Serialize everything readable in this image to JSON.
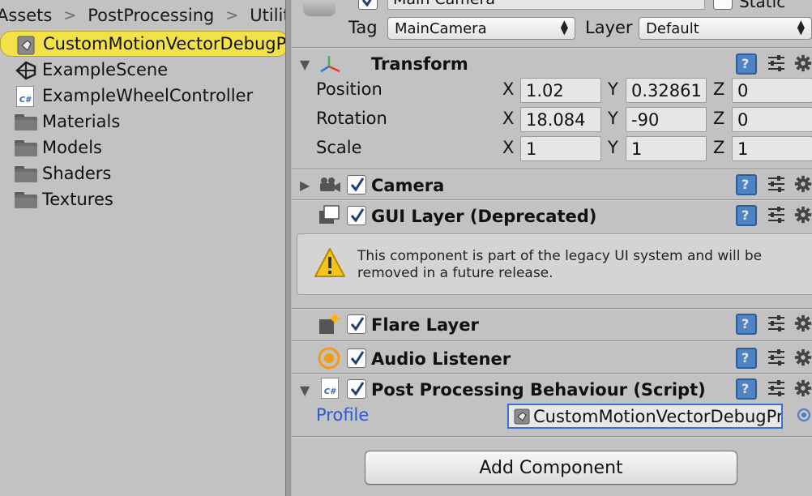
{
  "project": {
    "breadcrumb": [
      "Assets",
      "PostProcessing",
      "Utilit"
    ],
    "items": [
      {
        "label": "CustomMotionVectorDebugProfile",
        "icon": "unity-asset-icon",
        "selected": true
      },
      {
        "label": "ExampleScene",
        "icon": "unity-scene-icon"
      },
      {
        "label": "ExampleWheelController",
        "icon": "csharp-script-icon"
      },
      {
        "label": "Materials",
        "icon": "folder-icon"
      },
      {
        "label": "Models",
        "icon": "folder-icon"
      },
      {
        "label": "Shaders",
        "icon": "folder-icon"
      },
      {
        "label": "Textures",
        "icon": "folder-icon"
      }
    ]
  },
  "inspector": {
    "gameobject": {
      "name_value": "Main Camera",
      "static_label": "Static",
      "tag_label": "Tag",
      "tag_value": "MainCamera",
      "layer_label": "Layer",
      "layer_value": "Default"
    },
    "transform": {
      "title": "Transform",
      "position_label": "Position",
      "rotation_label": "Rotation",
      "scale_label": "Scale",
      "axis_x": "X",
      "axis_y": "Y",
      "axis_z": "Z",
      "position": {
        "x": "1.02",
        "y": "0.32861",
        "z": "0"
      },
      "rotation": {
        "x": "18.084",
        "y": "-90",
        "z": "0"
      },
      "scale": {
        "x": "1",
        "y": "1",
        "z": "1"
      }
    },
    "components": {
      "camera": "Camera",
      "gui_layer": "GUI Layer (Deprecated)",
      "gui_layer_warning": "This component is part of the legacy UI system and will be removed in a future release.",
      "flare_layer": "Flare Layer",
      "audio_listener": "Audio Listener",
      "post_processing": "Post Processing Behaviour (Script)",
      "profile_label": "Profile",
      "profile_value": "CustomMotionVectorDebugProfile"
    },
    "add_component_label": "Add Component"
  },
  "colors": {
    "selection": "#f3e14a",
    "link_blue": "#2a5bd3",
    "field_focus": "#3c6fd1",
    "help_icon": "#4f83c4"
  }
}
